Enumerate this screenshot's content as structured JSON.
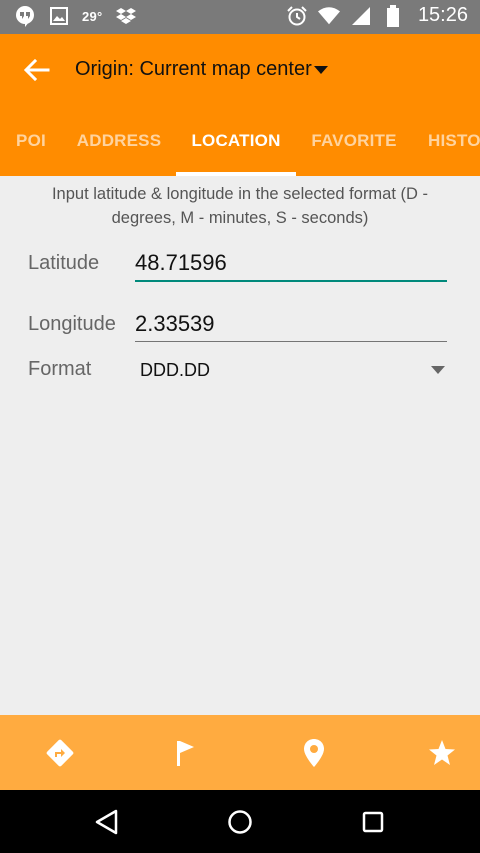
{
  "status_bar": {
    "temperature": "29°",
    "time": "15:26",
    "left_icons": [
      "hangouts-icon",
      "image-icon",
      "dropbox-icon"
    ],
    "right_icons": [
      "alarm-icon",
      "wifi-icon",
      "signal-icon",
      "battery-icon"
    ]
  },
  "app_bar": {
    "title": "Origin: Current map center",
    "background": "#ff8c00"
  },
  "tabs": [
    {
      "label": "POI"
    },
    {
      "label": "ADDRESS"
    },
    {
      "label": "LOCATION",
      "active": true
    },
    {
      "label": "FAVORITE"
    },
    {
      "label": "HISTO"
    }
  ],
  "form": {
    "instructions": "Input latitude & longitude in the selected format (D - degrees, M - minutes, S - seconds)",
    "latitude": {
      "label": "Latitude",
      "value": "48.71596"
    },
    "longitude": {
      "label": "Longitude",
      "value": "2.33539"
    },
    "format": {
      "label": "Format",
      "value": "DDD.DD"
    },
    "focus_color": "#00897b"
  },
  "bottom_bar": {
    "background": "#ffab40",
    "buttons": [
      "directions-icon",
      "flag-icon",
      "map-pin-icon",
      "star-icon"
    ]
  },
  "nav_bar": {
    "buttons": [
      "back-triangle-icon",
      "home-circle-icon",
      "recents-square-icon"
    ]
  }
}
